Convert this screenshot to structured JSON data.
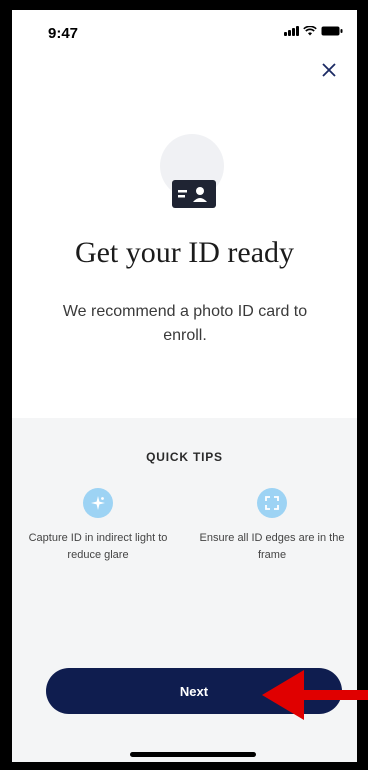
{
  "status_bar": {
    "time": "9:47"
  },
  "screen": {
    "headline": "Get your ID ready",
    "subtext": "We recommend a photo ID card to enroll."
  },
  "tips": {
    "title": "QUICK TIPS",
    "items": [
      {
        "text": "Capture ID in indirect light to reduce glare",
        "icon": "sparkle-icon"
      },
      {
        "text": "Ensure all ID edges are in the frame",
        "icon": "frame-corners-icon"
      }
    ]
  },
  "actions": {
    "next_label": "Next",
    "close_icon": "close-icon"
  },
  "colors": {
    "primary": "#0f1d4f",
    "tip_icon_bg": "#9dd3f4",
    "panel_bg": "#f4f5f6",
    "annotation_arrow": "#e00000"
  }
}
